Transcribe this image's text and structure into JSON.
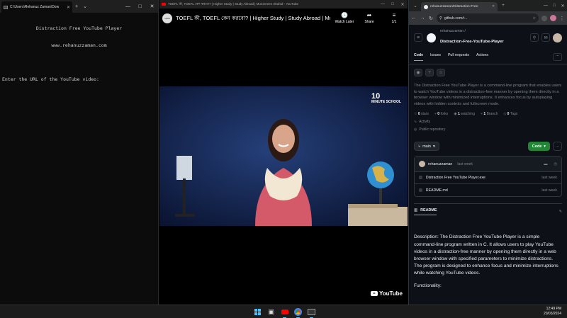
{
  "terminal": {
    "tab_title": "C:\\Users\\Rehanuz Zaman\\Dow",
    "new_tab": "+",
    "dropdown": "⌄",
    "win_min": "—",
    "win_max": "□",
    "win_close": "✕",
    "app_title": "Distraction Free YouTube Player",
    "app_site": "www.rehanuzzaman.com",
    "prompt": "Enter the URL of the YouTube video:"
  },
  "youtube": {
    "window_title": "TOEFL কী, TOEFL কেন করবো? | Higher Study | Study Abroad | Munzereen Shahid - YouTube",
    "video_title": "TOEFL কী, TOEFL কেন করবো? | Higher Study | Study Abroad | Munz...",
    "channel_avatar": "10MS",
    "watch_later": "Watch Later",
    "share": "Share",
    "playlist_count": "1/1",
    "watermark_number": "10",
    "watermark_text": "MINUTE SCHOOL",
    "logo_text": "YouTube"
  },
  "browser": {
    "tab_title": "rehanuzzaman/Distraction-Free-",
    "url": "github.com/r...",
    "new_tab": "+"
  },
  "github": {
    "owner": "rehanuzzaman /",
    "repo": "Distraction-Free-YouTube-Player",
    "nav": [
      "Code",
      "Issues",
      "Pull requests",
      "Actions"
    ],
    "description": "The Distraction Free YouTube Player is a command-line program that enables users to watch YouTube videos in a distraction-free manner by opening them directly in a browser window with minimized interruptions. It enhances focus by autoplaying videos with hidden controls and fullscreen mode.",
    "stars": "0",
    "stars_label": "stars",
    "forks": "0",
    "forks_label": "forks",
    "watching": "1",
    "watching_label": "watching",
    "branches": "1",
    "branches_label": "Branch",
    "tags": "0",
    "tags_label": "Tags",
    "activity": "Activity",
    "visibility": "Public repository",
    "branch": "main",
    "code_button": "Code",
    "commit_author": "rehanuzzaman",
    "commit_time": "last week",
    "files": [
      {
        "name": "Distraction Free YouTube Player.exe",
        "time": "last week"
      },
      {
        "name": "README.md",
        "time": "last week"
      }
    ],
    "readme_label": "README",
    "readme_text": "Description: The Distraction Free YouTube Player is a simple command-line program written in C. It allows users to play YouTube videos in a distraction-free manner by opening them directly in a web browser window with specified parameters to minimize distractions. The program is designed to enhance focus and minimize interruptions while watching YouTube videos.",
    "readme_next": "Functionality:"
  },
  "taskbar": {
    "time": "12:49 PM",
    "date": "20/03/2024"
  }
}
